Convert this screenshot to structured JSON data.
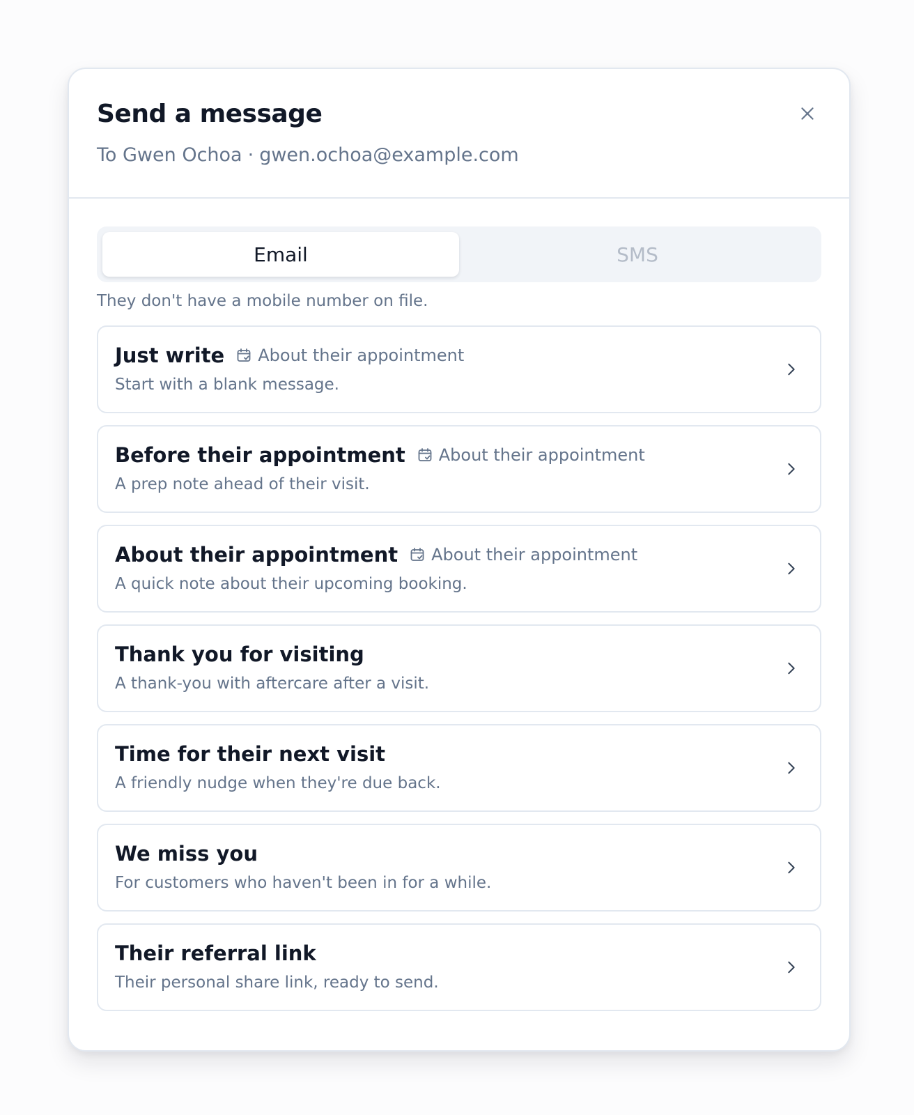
{
  "dialog": {
    "title": "Send a message",
    "recipient_name": "To Gwen Ochoa",
    "separator": "·",
    "recipient_email": "gwen.ochoa@example.com",
    "close_icon": "close-icon"
  },
  "channel_tabs": {
    "email": "Email",
    "sms": "SMS",
    "selected": "Email"
  },
  "notice": "They don't have a mobile number on file.",
  "templates": [
    {
      "title": "Just write",
      "tag": "About their appointment",
      "description": "Start with a blank message."
    },
    {
      "title": "Before their appointment",
      "tag": "About their appointment",
      "description": "A prep note ahead of their visit."
    },
    {
      "title": "About their appointment",
      "tag": "About their appointment",
      "description": "A quick note about their upcoming booking."
    },
    {
      "title": "Thank you for visiting",
      "tag": "",
      "description": "A thank-you with aftercare after a visit."
    },
    {
      "title": "Time for their next visit",
      "tag": "",
      "description": "A friendly nudge when they're due back."
    },
    {
      "title": "We miss you",
      "tag": "",
      "description": "For customers who haven't been in for a while."
    },
    {
      "title": "Their referral link",
      "tag": "",
      "description": "Their personal share link, ready to send."
    }
  ],
  "colors": {
    "text_primary": "#111827",
    "text_muted": "#64748b",
    "border": "#e2e8f0",
    "segment_bg": "#f1f4f8"
  }
}
